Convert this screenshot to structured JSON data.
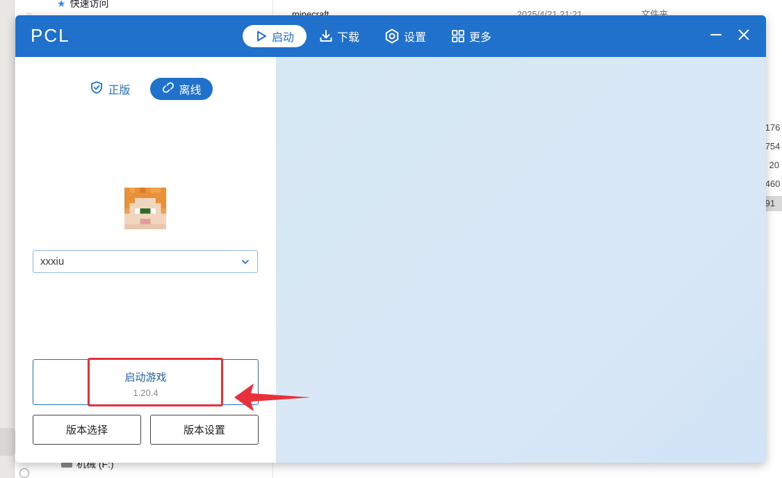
{
  "background": {
    "quick_access": "快速访问",
    "folder_name": "minecraft",
    "folder_date": "2025/4/21 21:21",
    "folder_type": "文件夹",
    "sizes": [
      ",176",
      ",754",
      "20",
      ",460",
      ",91"
    ],
    "drive_label": "机械 (F:)"
  },
  "app": {
    "title": "PCL",
    "nav": [
      {
        "label": "启动",
        "icon": "play-icon",
        "active": true
      },
      {
        "label": "下载",
        "icon": "download-icon",
        "active": false
      },
      {
        "label": "设置",
        "icon": "settings-icon",
        "active": false
      },
      {
        "label": "更多",
        "icon": "grid-icon",
        "active": false
      }
    ],
    "window_controls": [
      "minimize-icon",
      "close-icon"
    ]
  },
  "sidebar": {
    "modes": [
      {
        "label": "正版",
        "icon": "shield-check-icon",
        "active": false
      },
      {
        "label": "离线",
        "icon": "link-broken-icon",
        "active": true
      }
    ],
    "username": "xxxiu",
    "launch": {
      "label": "启动游戏",
      "version": "1.20.4"
    },
    "version_select_label": "版本选择",
    "version_settings_label": "版本设置"
  },
  "colors": {
    "accent": "#1f71cc",
    "annotation": "#e8303a",
    "content_bg": "#d6e8f4"
  }
}
